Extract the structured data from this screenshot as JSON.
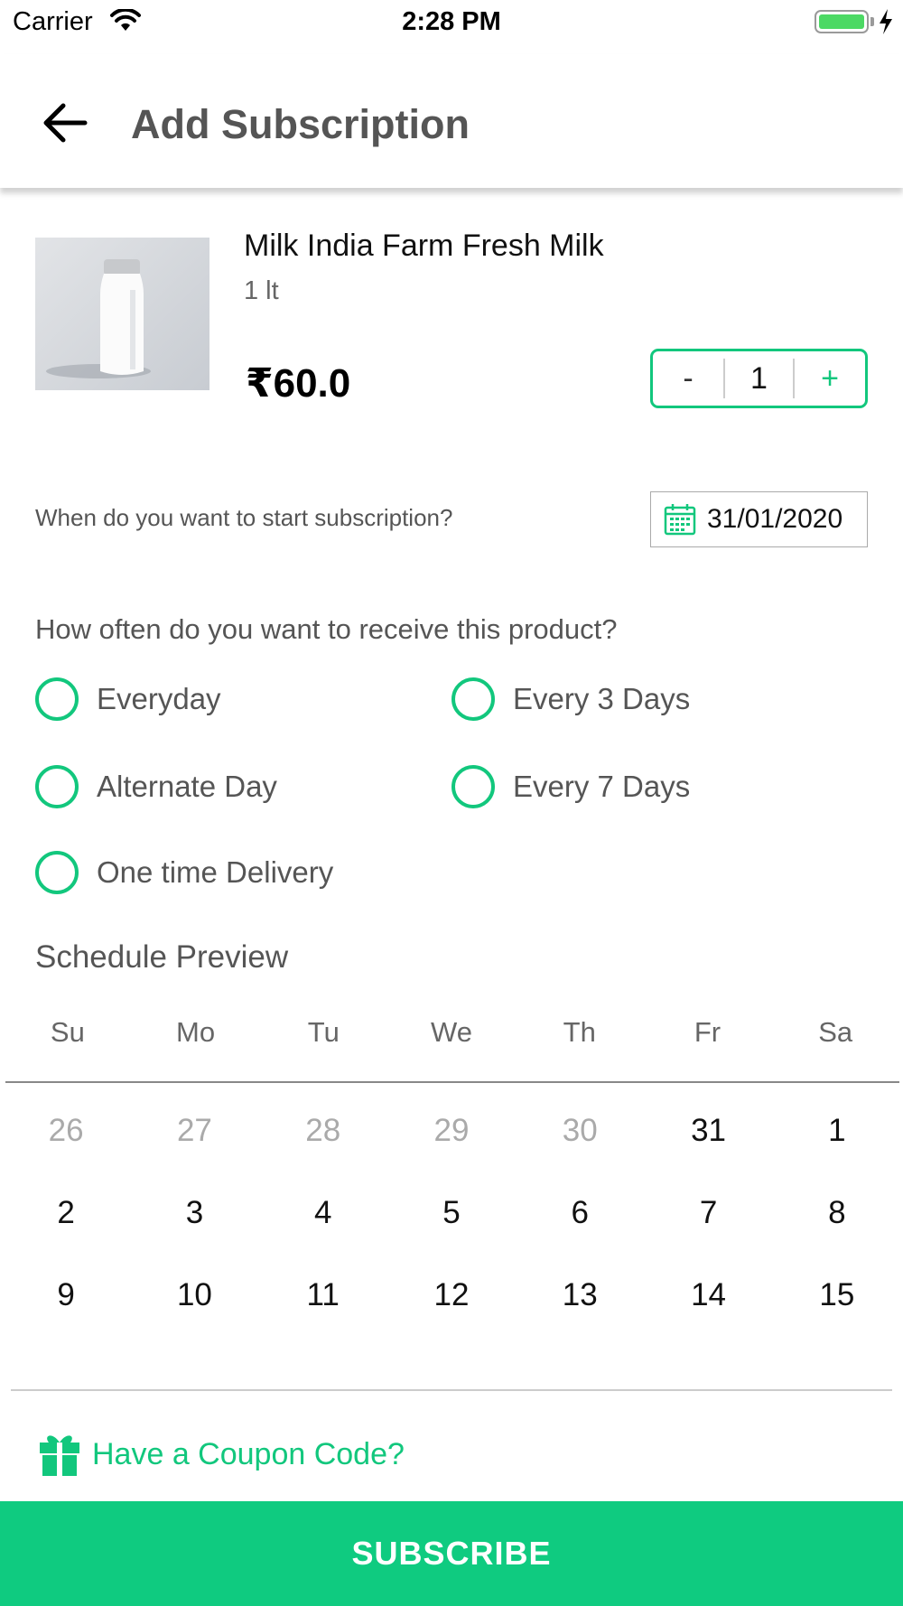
{
  "status_bar": {
    "carrier": "Carrier",
    "time": "2:28 PM",
    "battery_level": 1.0,
    "wifi_icon": "wifi-icon",
    "battery_icon": "battery-icon",
    "charging_icon": "charging-bolt-icon"
  },
  "header": {
    "title": "Add Subscription",
    "back_icon": "arrow-left-icon"
  },
  "product": {
    "name": "Milk India Farm Fresh Milk",
    "unit": "1 lt",
    "price": "₹60.0",
    "image_label": "milk",
    "quantity": "1",
    "minus_label": "-",
    "plus_label": "+"
  },
  "start": {
    "question": "When do you want to start subscription?",
    "date": "31/01/2020",
    "calendar_icon": "calendar-icon"
  },
  "frequency": {
    "question": "How often do you want to receive this product?",
    "options": [
      "Everyday",
      "Every 3 Days",
      "Alternate Day",
      "Every 7 Days",
      "One time Delivery"
    ],
    "selected": null
  },
  "schedule": {
    "title": "Schedule Preview",
    "weekdays": [
      "Su",
      "Mo",
      "Tu",
      "We",
      "Th",
      "Fr",
      "Sa"
    ],
    "weeks": [
      [
        "26",
        "27",
        "28",
        "29",
        "30",
        "31",
        "1"
      ],
      [
        "2",
        "3",
        "4",
        "5",
        "6",
        "7",
        "8"
      ],
      [
        "9",
        "10",
        "11",
        "12",
        "13",
        "14",
        "15"
      ]
    ],
    "muted_days": [
      "26",
      "27",
      "28",
      "29",
      "30"
    ]
  },
  "coupon": {
    "label": "Have a Coupon Code?",
    "icon": "gift-icon"
  },
  "subscribe_label": "SUBSCRIBE",
  "colors": {
    "accent": "#12c77d",
    "button": "#0fcb80",
    "text_secondary": "#555555"
  }
}
